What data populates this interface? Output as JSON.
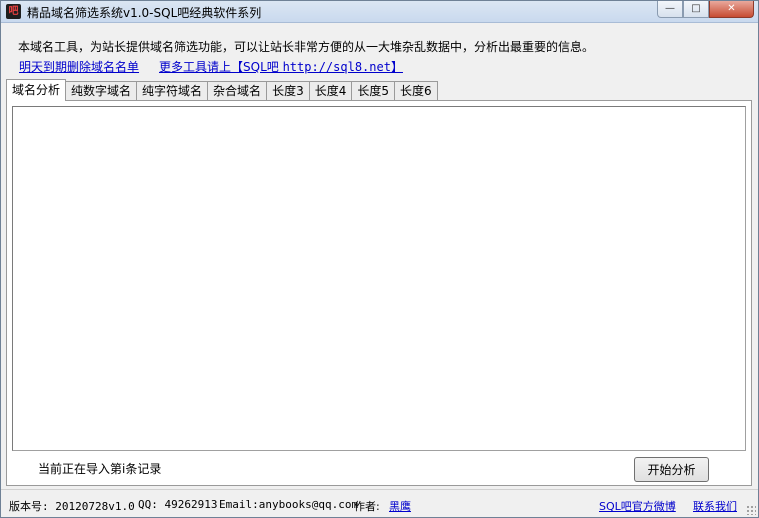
{
  "window": {
    "title": "精品域名筛选系统v1.0-SQL吧经典软件系列",
    "icon_glyph": "吧",
    "icon": "app-logo-icon",
    "controls": {
      "minimize": "—",
      "maximize": "□",
      "close": "✕"
    }
  },
  "header": {
    "description": "本域名工具，为站长提供域名筛选功能，可以让站长非常方便的从一大堆杂乱数据中，分析出最重要的信息。",
    "link_expiring": "明天到期删除域名名单",
    "link_more_prefix": "更多工具请上【SQL吧 ",
    "link_more_url": "http://sql8.net",
    "link_more_suffix": "】"
  },
  "tabs": [
    {
      "label": "域名分析"
    },
    {
      "label": "纯数字域名"
    },
    {
      "label": "纯字符域名"
    },
    {
      "label": "杂合域名"
    },
    {
      "label": "长度3"
    },
    {
      "label": "长度4"
    },
    {
      "label": "长度5"
    },
    {
      "label": "长度6"
    }
  ],
  "panel": {
    "textarea_value": "",
    "status_text": "当前正在导入第i条记录",
    "start_button": "开始分析"
  },
  "footer": {
    "version": "版本号: 20120728v1.0",
    "qq": "QQ: 49262913",
    "email": "Email:anybooks@qq.com",
    "author_label": "作者:",
    "author_name": "黑鹰",
    "weibo_link": "SQL吧官方微博",
    "contact_link": "联系我们"
  }
}
